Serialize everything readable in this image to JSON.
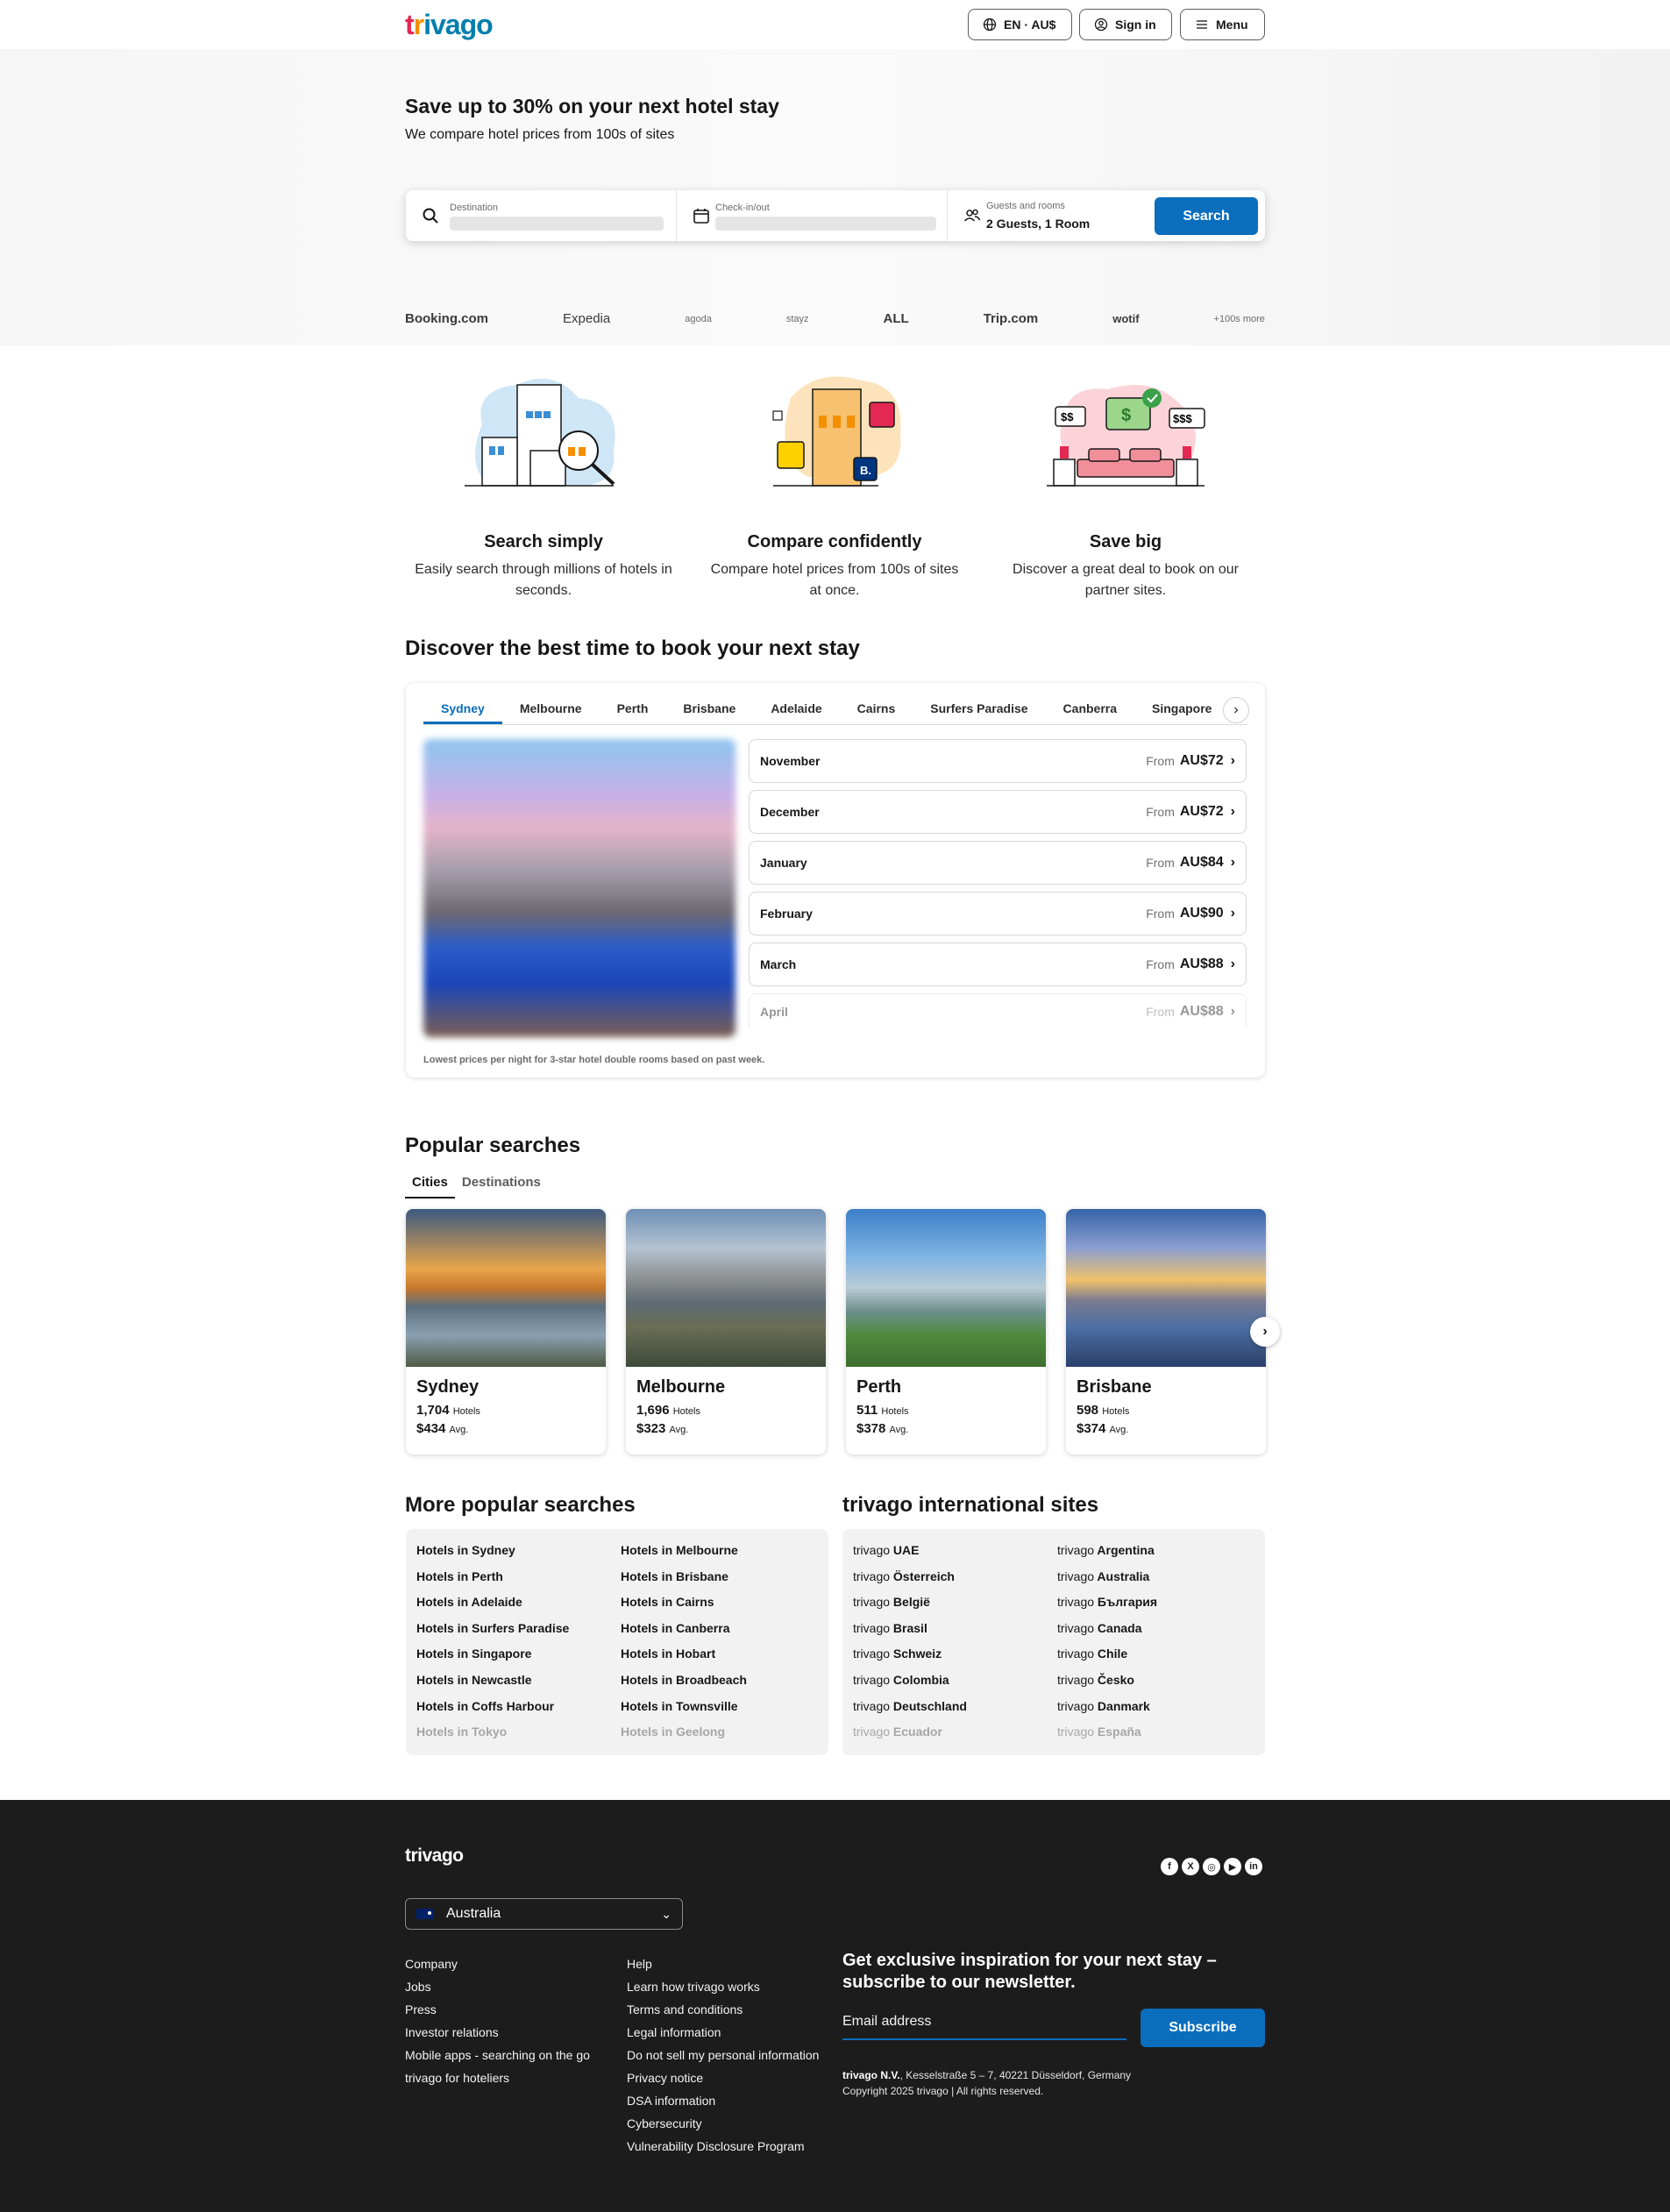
{
  "header": {
    "logo": "trivago",
    "lang_button": "EN · AU$",
    "signin_button": "Sign in",
    "menu_button": "Menu"
  },
  "hero": {
    "title": "Save up to 30% on your next hotel stay",
    "subtitle": "We compare hotel prices from 100s of sites",
    "destination_label": "Destination",
    "checkin_label": "Check-in/out",
    "guests_label": "Guests and rooms",
    "guests_value": "2 Guests, 1 Room",
    "search_button": "Search",
    "partners": [
      "Booking.com",
      "Expedia",
      "agoda",
      "stayz",
      "ALL",
      "Trip.com",
      "wotif",
      "+100s more"
    ]
  },
  "features": [
    {
      "title": "Search simply",
      "text": "Easily search through millions of hotels in seconds."
    },
    {
      "title": "Compare confidently",
      "text": "Compare hotel prices from 100s of sites at once."
    },
    {
      "title": "Save big",
      "text": "Discover a great deal to book on our partner sites."
    }
  ],
  "discover": {
    "title": "Discover the best time to book your next stay",
    "tabs": [
      "Sydney",
      "Melbourne",
      "Perth",
      "Brisbane",
      "Adelaide",
      "Cairns",
      "Surfers Paradise",
      "Canberra",
      "Singapore"
    ],
    "months": [
      {
        "month": "November",
        "from": "From",
        "price": "AU$72"
      },
      {
        "month": "December",
        "from": "From",
        "price": "AU$72"
      },
      {
        "month": "January",
        "from": "From",
        "price": "AU$84"
      },
      {
        "month": "February",
        "from": "From",
        "price": "AU$90"
      },
      {
        "month": "March",
        "from": "From",
        "price": "AU$88"
      },
      {
        "month": "April",
        "from": "From",
        "price": "AU$88"
      }
    ],
    "note": "Lowest prices per night for 3-star hotel double rooms based on past week."
  },
  "popular": {
    "title": "Popular searches",
    "tabs": [
      "Cities",
      "Destinations"
    ],
    "cards": [
      {
        "name": "Sydney",
        "hotels": "1,704",
        "hotels_label": "Hotels",
        "avg": "$434",
        "avg_label": "Avg."
      },
      {
        "name": "Melbourne",
        "hotels": "1,696",
        "hotels_label": "Hotels",
        "avg": "$323",
        "avg_label": "Avg."
      },
      {
        "name": "Perth",
        "hotels": "511",
        "hotels_label": "Hotels",
        "avg": "$378",
        "avg_label": "Avg."
      },
      {
        "name": "Brisbane",
        "hotels": "598",
        "hotels_label": "Hotels",
        "avg": "$374",
        "avg_label": "Avg."
      }
    ]
  },
  "more_popular": {
    "title": "More popular searches",
    "left": [
      "Hotels in Sydney",
      "Hotels in Perth",
      "Hotels in Adelaide",
      "Hotels in Surfers Paradise",
      "Hotels in Singapore",
      "Hotels in Newcastle",
      "Hotels in Coffs Harbour",
      "Hotels in Tokyo"
    ],
    "right": [
      "Hotels in Melbourne",
      "Hotels in Brisbane",
      "Hotels in Cairns",
      "Hotels in Canberra",
      "Hotels in Hobart",
      "Hotels in Broadbeach",
      "Hotels in Townsville",
      "Hotels in Geelong"
    ]
  },
  "international": {
    "title": "trivago international sites",
    "prefix": "trivago",
    "left": [
      "UAE",
      "Österreich",
      "België",
      "Brasil",
      "Schweiz",
      "Colombia",
      "Deutschland",
      "Ecuador"
    ],
    "right": [
      "Argentina",
      "Australia",
      "България",
      "Canada",
      "Chile",
      "Česko",
      "Danmark",
      "España"
    ]
  },
  "footer": {
    "logo": "trivago",
    "country": "Australia",
    "col1": [
      "Company",
      "Jobs",
      "Press",
      "Investor relations",
      "Mobile apps - searching on the go",
      "trivago for hoteliers"
    ],
    "col2": [
      "Help",
      "Learn how trivago works",
      "Terms and conditions",
      "Legal information",
      "Do not sell my personal information",
      "Privacy notice",
      "DSA information",
      "Cybersecurity",
      "Vulnerability Disclosure Program"
    ],
    "newsletter_title": "Get exclusive inspiration for your next stay – subscribe to our newsletter.",
    "email_placeholder": "Email address",
    "subscribe_button": "Subscribe",
    "company": "trivago N.V.",
    "address": ", Kesselstraße 5 – 7, 40221 Düsseldorf, Germany",
    "copyright": "Copyright 2025 trivago | All rights reserved."
  }
}
